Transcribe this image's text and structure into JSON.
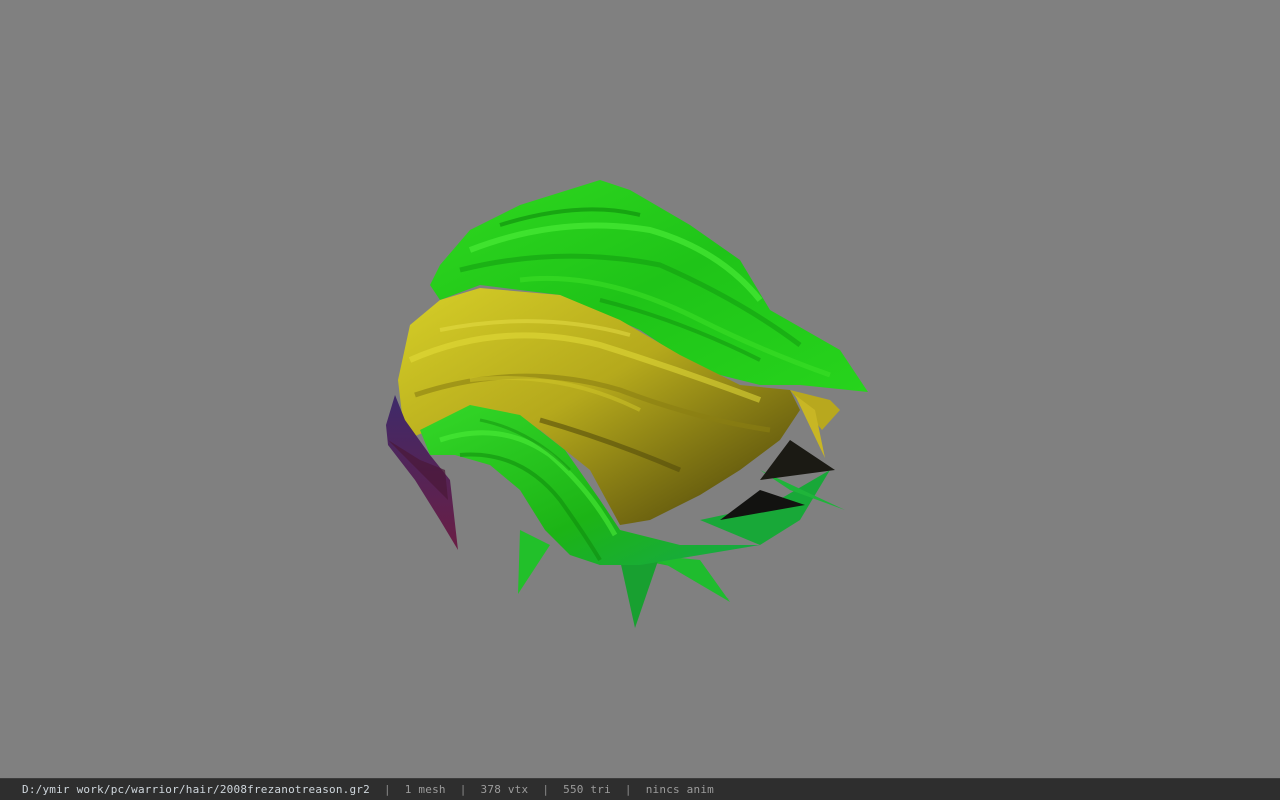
{
  "status_bar": {
    "file_path": "D:/ymir work/pc/warrior/hair/2008frezanotreason.gr2",
    "separator": "|",
    "mesh_count": "1 mesh",
    "vertex_count": "378 vtx",
    "triangle_count": "550 tri",
    "anim_status": "nincs anim"
  },
  "viewport": {
    "background_color": "#808080",
    "model": {
      "kind": "hair mesh",
      "colors": {
        "primary_green": "#22c81a",
        "light_green": "#3ee028",
        "dark_green": "#129a10",
        "yellow_band": "#c8c020",
        "dark_yellow": "#6e6410",
        "purple": "#5a2048",
        "teal": "#1aa870"
      }
    }
  }
}
